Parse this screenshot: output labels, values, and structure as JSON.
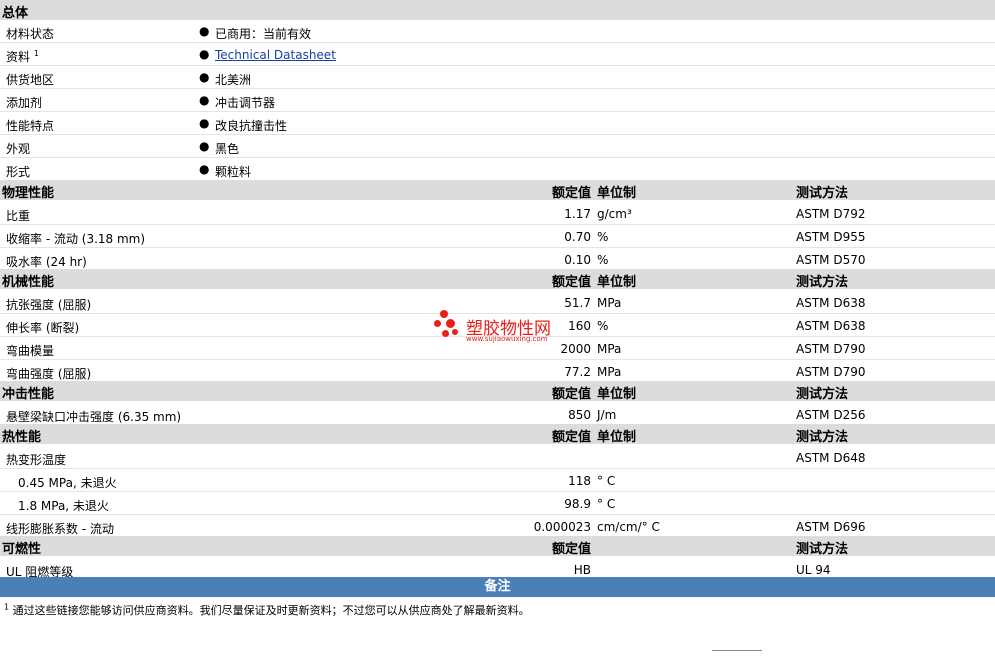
{
  "general": {
    "title": "总体",
    "rows": [
      {
        "label": "材料状态",
        "value": "已商用：当前有效"
      },
      {
        "label": "资料",
        "sup": "1",
        "value": "Technical Datasheet"
      },
      {
        "label": "供货地区",
        "value": "北美洲"
      },
      {
        "label": "添加剂",
        "value": "冲击调节器"
      },
      {
        "label": "性能特点",
        "value": "改良抗撞击性"
      },
      {
        "label": "外观",
        "value": "黑色"
      },
      {
        "label": "形式",
        "value": "颗粒料"
      }
    ]
  },
  "columns": {
    "nominal": "额定值",
    "unit": "单位制",
    "method": "测试方法"
  },
  "physical": {
    "title": "物理性能",
    "rows": [
      {
        "label": "比重",
        "num": "1.17",
        "unit": "g/cm³",
        "method": "ASTM D792"
      },
      {
        "label": "收缩率 - 流动 (3.18 mm)",
        "num": "0.70",
        "unit": "%",
        "method": "ASTM D955"
      },
      {
        "label": "吸水率 (24 hr)",
        "num": "0.10",
        "unit": "%",
        "method": "ASTM D570"
      }
    ]
  },
  "mechanical": {
    "title": "机械性能",
    "rows": [
      {
        "label": "抗张强度 (屈服)",
        "num": "51.7",
        "unit": "MPa",
        "method": "ASTM D638"
      },
      {
        "label": "伸长率 (断裂)",
        "num": "160",
        "unit": "%",
        "method": "ASTM D638"
      },
      {
        "label": "弯曲模量",
        "num": "2000",
        "unit": "MPa",
        "method": "ASTM D790"
      },
      {
        "label": "弯曲强度 (屈服)",
        "num": "77.2",
        "unit": "MPa",
        "method": "ASTM D790"
      }
    ]
  },
  "impact": {
    "title": "冲击性能",
    "rows": [
      {
        "label": "悬壁梁缺口冲击强度 (6.35 mm)",
        "num": "850",
        "unit": "J/m",
        "method": "ASTM D256"
      }
    ]
  },
  "thermal": {
    "title": "热性能",
    "rows": [
      {
        "label": "热变形温度",
        "num": "",
        "unit": "",
        "method": "ASTM D648"
      },
      {
        "label": "0.45 MPa, 未退火",
        "num": "118",
        "unit": "° C",
        "method": ""
      },
      {
        "label": "1.8 MPa, 未退火",
        "num": "98.9",
        "unit": "° C",
        "method": ""
      },
      {
        "label": "线形膨胀系数 - 流动",
        "num": "0.000023",
        "unit": "cm/cm/° C",
        "method": "ASTM D696"
      }
    ]
  },
  "flammability": {
    "title": "可燃性",
    "rows": [
      {
        "label": "UL 阻燃等级",
        "num": "HB",
        "unit": "",
        "method": "UL 94"
      }
    ]
  },
  "notes": {
    "title": "备注",
    "footnote_mark": "1",
    "footnote": "通过这些链接您能够访问供应商资料。我们尽量保证及时更新资料；不过您可以从供应商处了解最新资料。"
  },
  "watermark": {
    "name": "塑胶物性网",
    "url": "www.sujiaowuxing.com"
  }
}
